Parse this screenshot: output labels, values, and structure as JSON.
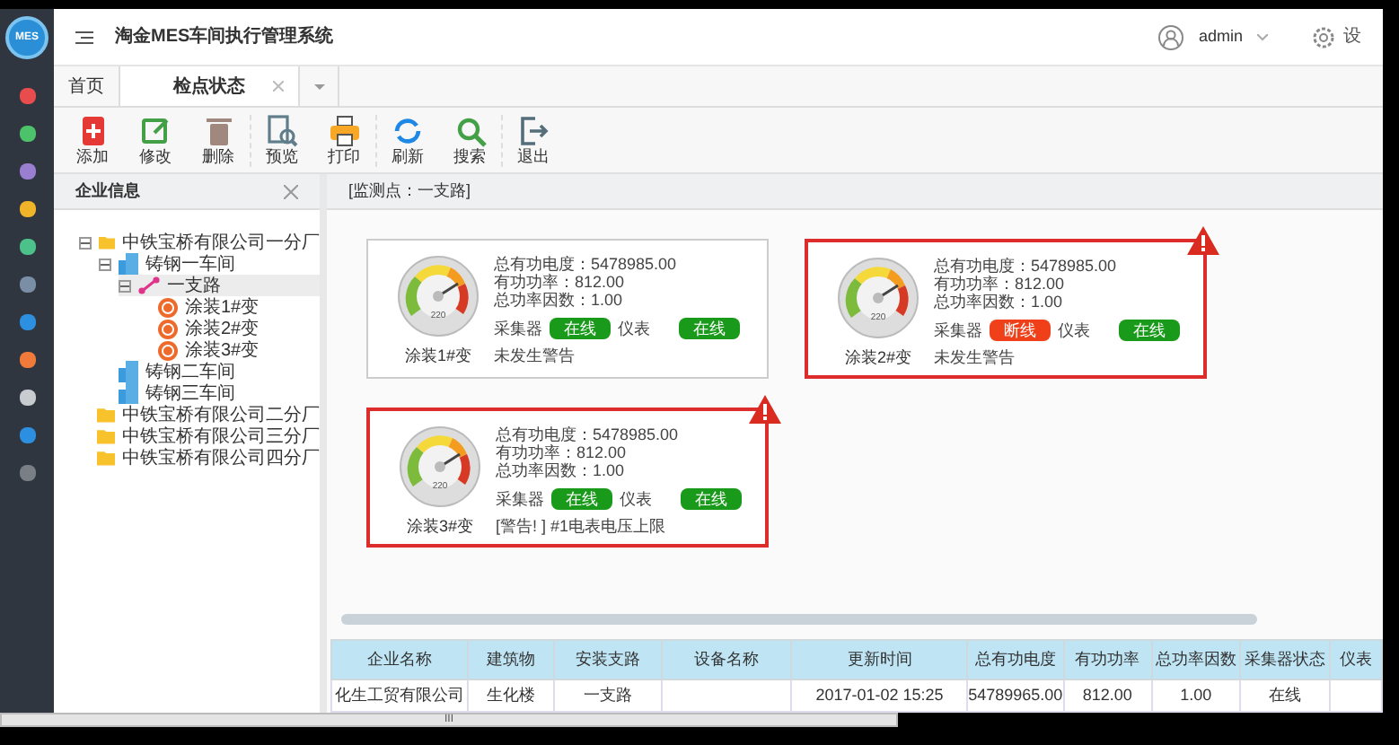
{
  "app": {
    "logo": "MES",
    "title": "淘金MES车间执行管理系统",
    "user": "admin",
    "settings": "设"
  },
  "sidebar": {
    "items": [
      {
        "color": "#e84c4c"
      },
      {
        "color": "#4cc26a"
      },
      {
        "color": "#9a7fd0"
      },
      {
        "color": "#f0b429"
      },
      {
        "color": "#4cc28a"
      },
      {
        "color": "#7a8fa6"
      },
      {
        "color": "#2d8fe0"
      },
      {
        "color": "#f07a3a"
      },
      {
        "color": "#c8ccd0"
      },
      {
        "color": "#2d8fe0"
      },
      {
        "color": "#7a7f85"
      }
    ]
  },
  "tabs": [
    {
      "label": "首页",
      "selected": false,
      "closable": false
    },
    {
      "label": "检点状态",
      "selected": true,
      "closable": true
    }
  ],
  "toolbar": [
    {
      "label": "添加",
      "kind": "add"
    },
    {
      "label": "修改",
      "kind": "edit"
    },
    {
      "label": "删除",
      "kind": "delete"
    },
    {
      "label": "预览",
      "kind": "preview"
    },
    {
      "label": "打印",
      "kind": "print"
    },
    {
      "label": "刷新",
      "kind": "refresh"
    },
    {
      "label": "搜索",
      "kind": "search"
    },
    {
      "label": "退出",
      "kind": "exit"
    }
  ],
  "left_panel": {
    "title": "企业信息",
    "tree": [
      {
        "label": "中铁宝桥有限公司一分厂",
        "kind": "folder",
        "expanded": true,
        "selected": false,
        "children": [
          {
            "label": "铸钢一车间",
            "kind": "building",
            "expanded": true,
            "selected": false,
            "children": [
              {
                "label": "一支路",
                "kind": "branch",
                "expanded": true,
                "selected": true,
                "children": [
                  {
                    "label": "涂装1#变",
                    "kind": "device",
                    "selected": false
                  },
                  {
                    "label": "涂装2#变",
                    "kind": "device",
                    "selected": false
                  },
                  {
                    "label": "涂装3#变",
                    "kind": "device",
                    "selected": false
                  }
                ]
              }
            ]
          },
          {
            "label": "铸钢二车间",
            "kind": "building",
            "selected": false
          },
          {
            "label": "铸钢三车间",
            "kind": "building",
            "selected": false
          }
        ]
      },
      {
        "label": "中铁宝桥有限公司二分厂",
        "kind": "folder",
        "selected": false
      },
      {
        "label": "中铁宝桥有限公司三分厂",
        "kind": "folder",
        "selected": false
      },
      {
        "label": "中铁宝桥有限公司四分厂",
        "kind": "folder",
        "selected": false
      }
    ]
  },
  "monitor": {
    "heading": "[监测点：一支路]",
    "cards": [
      {
        "name": "涂装1#变",
        "gauge_label": "220",
        "lines": [
          "总有功电度：5478985.00",
          "有功功率：812.00",
          "总功率因数：1.00"
        ],
        "collector_label": "采集器",
        "collector_status": "在线",
        "collector_online": true,
        "meter_label": "仪表",
        "meter_status": "在线",
        "meter_online": true,
        "warning": "未发生警告",
        "alarm": false
      },
      {
        "name": "涂装2#变",
        "gauge_label": "220",
        "lines": [
          "总有功电度：5478985.00",
          "有功功率：812.00",
          "总功率因数：1.00"
        ],
        "collector_label": "采集器",
        "collector_status": "断线",
        "collector_online": false,
        "meter_label": "仪表",
        "meter_status": "在线",
        "meter_online": true,
        "warning": "未发生警告",
        "alarm": true
      },
      {
        "name": "涂装3#变",
        "gauge_label": "220",
        "lines": [
          "总有功电度：5478985.00",
          "有功功率：812.00",
          "总功率因数：1.00"
        ],
        "collector_label": "采集器",
        "collector_status": "在线",
        "collector_online": true,
        "meter_label": "仪表",
        "meter_status": "在线",
        "meter_online": true,
        "warning": "[警告! ] #1电表电压上限",
        "alarm": true
      }
    ]
  },
  "table": {
    "columns": [
      "企业名称",
      "建筑物",
      "安装支路",
      "设备名称",
      "更新时间",
      "总有功电度",
      "有功功率",
      "总功率因数",
      "采集器状态",
      "仪表"
    ],
    "rows": [
      [
        "化生工贸有限公司",
        "生化楼",
        "一支路",
        "",
        "2017-01-02 15:25",
        "54789965.00",
        "812.00",
        "1.00",
        "在线",
        ""
      ]
    ]
  },
  "scrollbar_grip": "III"
}
